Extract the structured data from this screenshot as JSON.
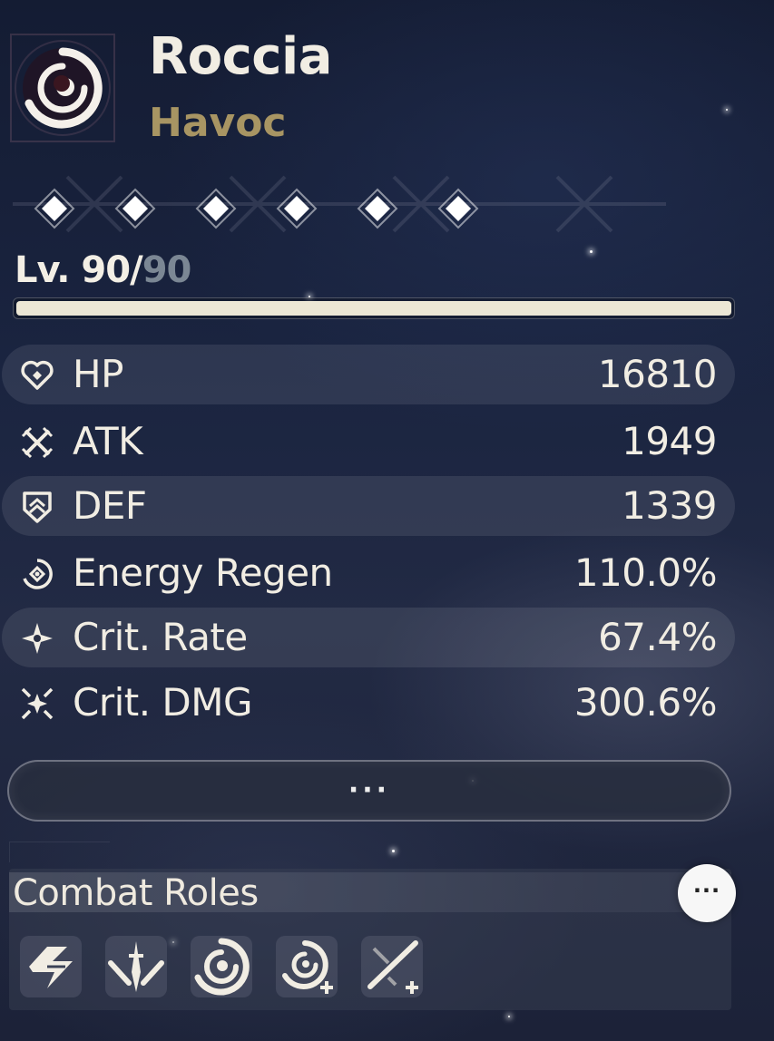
{
  "character": {
    "name": "Roccia",
    "attribute": "Havoc",
    "attribute_color": "#a89563"
  },
  "sequence": {
    "nodes_active": 6,
    "nodes_total": 6
  },
  "level": {
    "current": "90",
    "separator": "/",
    "max": "90",
    "progress": 1.0
  },
  "stats": [
    {
      "label": "HP",
      "value": "16810",
      "icon": "hp-heart-icon"
    },
    {
      "label": "ATK",
      "value": "1949",
      "icon": "atk-swords-icon"
    },
    {
      "label": "DEF",
      "value": "1339",
      "icon": "def-shield-icon"
    },
    {
      "label": "Energy Regen",
      "value": "110.0%",
      "icon": "energy-regen-icon"
    },
    {
      "label": "Crit. Rate",
      "value": "67.4%",
      "icon": "crit-rate-icon"
    },
    {
      "label": "Crit. DMG",
      "value": "300.6%",
      "icon": "crit-dmg-icon"
    }
  ],
  "more_button": {
    "label": "···"
  },
  "combat_roles": {
    "title": "Combat Roles",
    "more_label": "···",
    "roles": [
      {
        "icon": "lightning-slash-role-icon"
      },
      {
        "icon": "sword-burst-role-icon"
      },
      {
        "icon": "havoc-swirl-role-icon"
      },
      {
        "icon": "havoc-plus-role-icon"
      },
      {
        "icon": "crossed-swords-plus-role-icon"
      }
    ]
  }
}
